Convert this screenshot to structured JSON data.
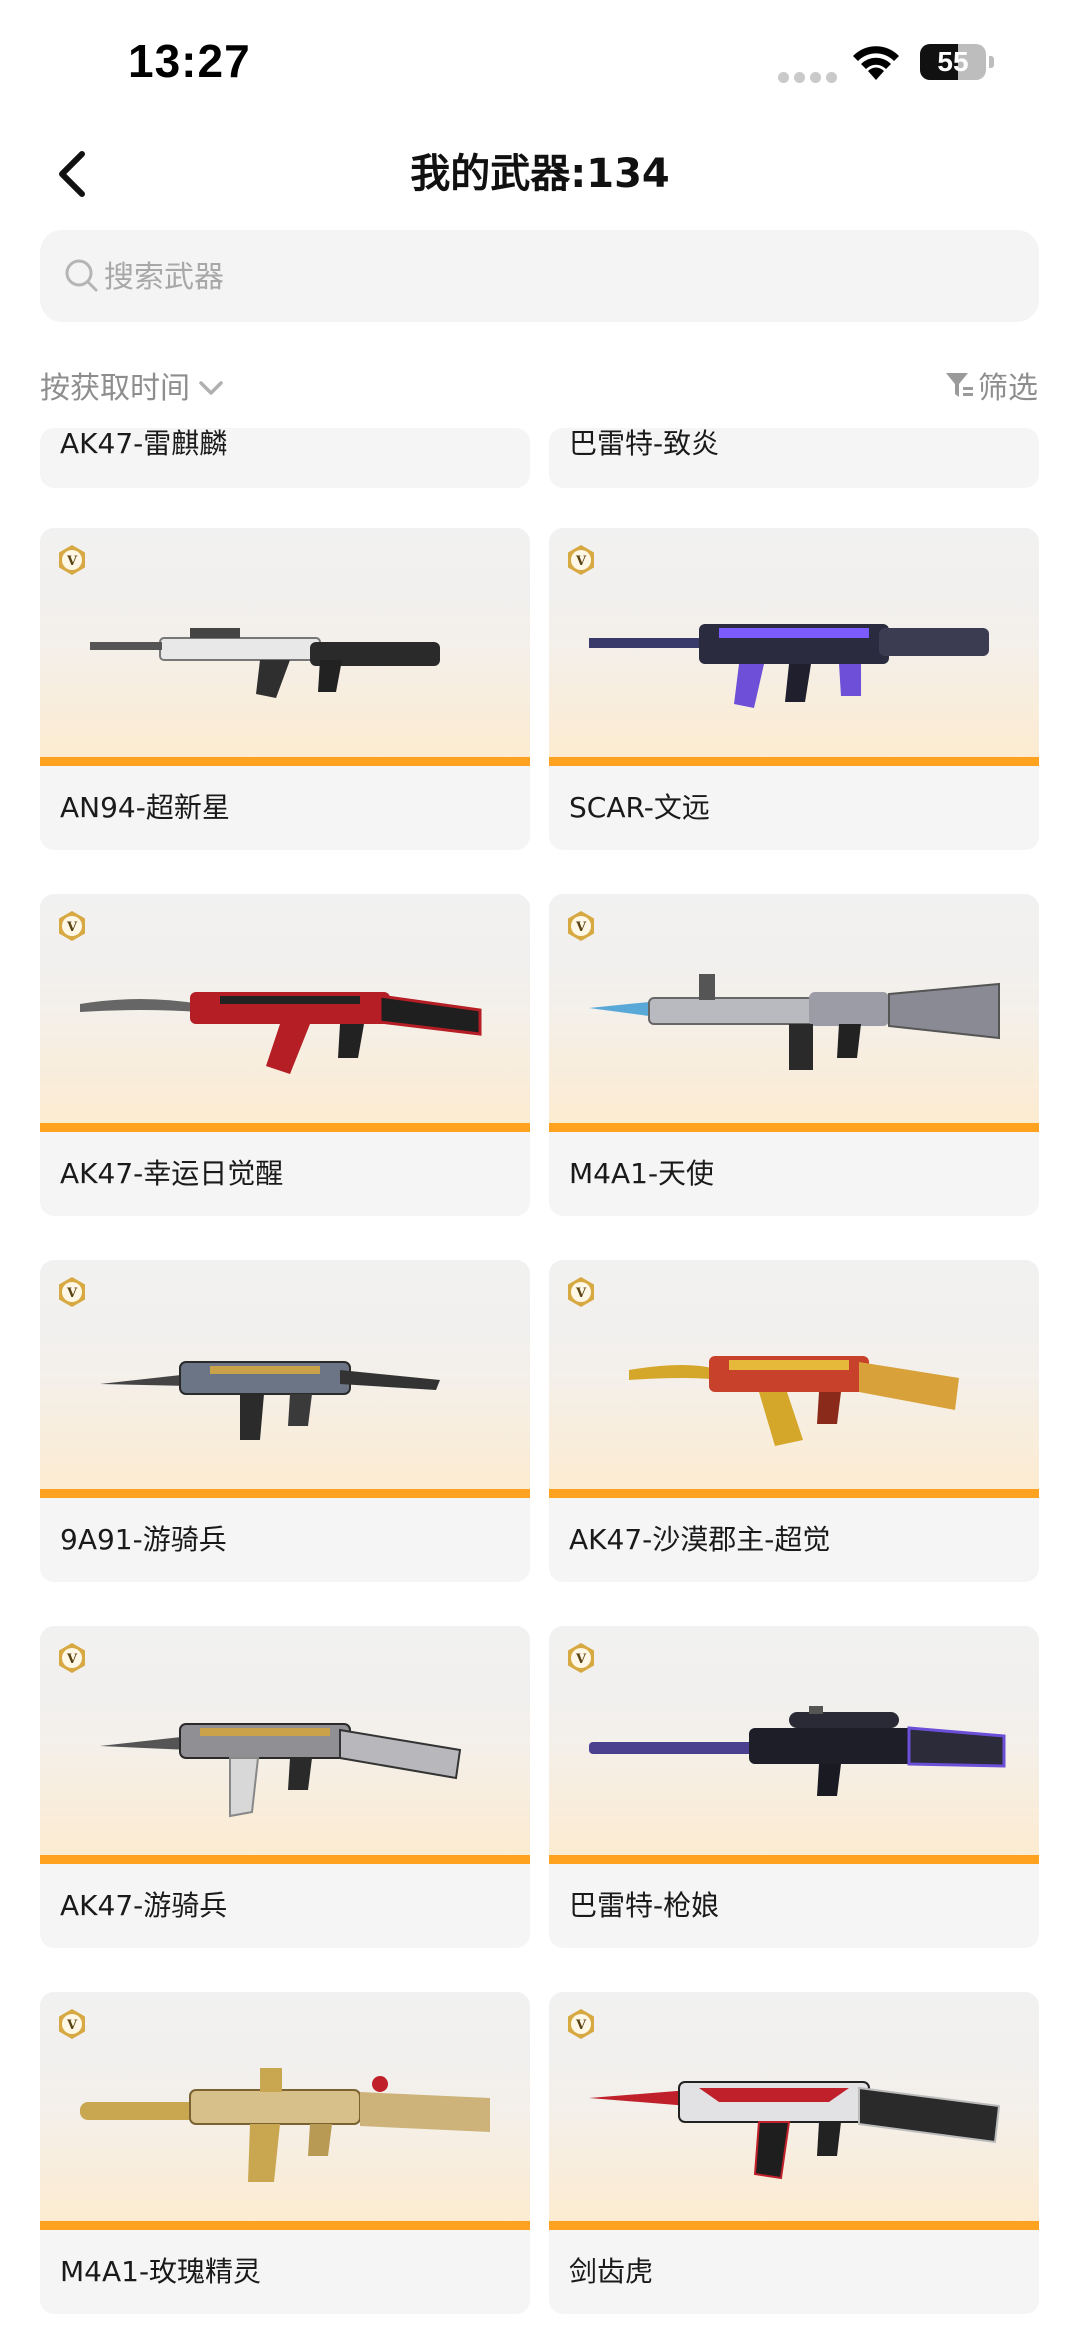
{
  "status_bar": {
    "time": "13:27",
    "battery": "55"
  },
  "header": {
    "title": "我的武器:134"
  },
  "search": {
    "placeholder": "搜索武器",
    "value": ""
  },
  "toolbar": {
    "sort_label": "按获取时间",
    "filter_label": "筛选"
  },
  "colors": {
    "accent_bar": "#ffa21f",
    "card_bg": "#f5f5f5",
    "search_bg": "#f4f4f4",
    "muted_text": "#8e8e8e"
  },
  "weapons": [
    {
      "name": "AK47-雷麒麟",
      "partial": true
    },
    {
      "name": "巴雷特-致炎",
      "partial": true
    },
    {
      "name": "AN94-超新星"
    },
    {
      "name": "SCAR-文远"
    },
    {
      "name": "AK47-幸运日觉醒"
    },
    {
      "name": "M4A1-天使"
    },
    {
      "name": "9A91-游骑兵"
    },
    {
      "name": "AK47-沙漠郡主-超觉"
    },
    {
      "name": "AK47-游骑兵"
    },
    {
      "name": "巴雷特-枪娘"
    },
    {
      "name": "M4A1-玫瑰精灵"
    },
    {
      "name": "剑齿虎"
    }
  ]
}
